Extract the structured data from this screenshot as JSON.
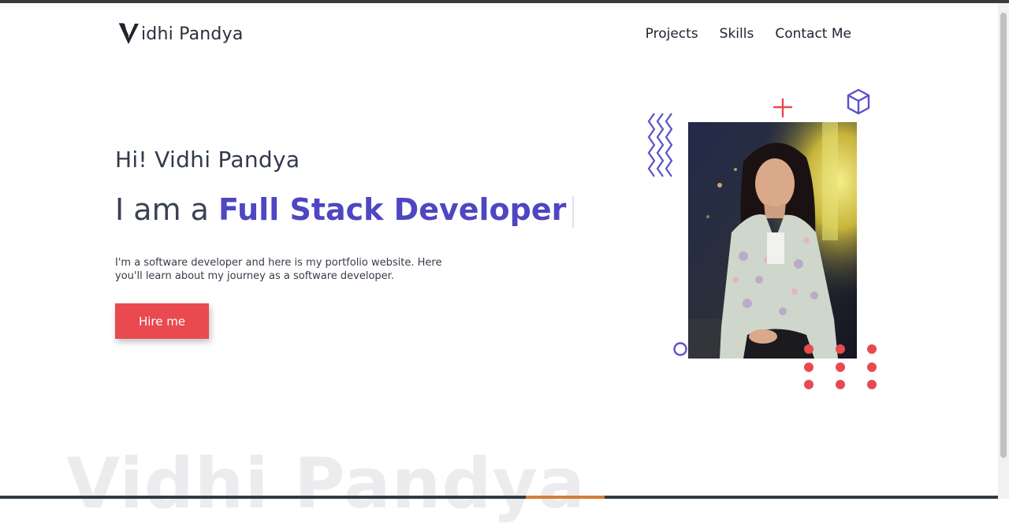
{
  "header": {
    "logo_text": "idhi Pandya",
    "nav": [
      {
        "label": "Projects"
      },
      {
        "label": "Skills"
      },
      {
        "label": "Contact Me"
      }
    ]
  },
  "hero": {
    "greeting": "Hi! Vidhi Pandya",
    "role_prefix": "I am a ",
    "role_highlight": "Full Stack Developer",
    "description": "I'm a software developer and here is my portfolio website. Here you'll learn about my journey as a software developer.",
    "cta_label": "Hire me"
  },
  "watermark": "Vidhi Pandya",
  "colors": {
    "accent_purple": "#4f46c2",
    "cta_red": "#e84a4f",
    "deco_purple": "#5b50c8",
    "deco_red": "#e84a4f"
  },
  "icons": {
    "logo_mark": "v-logo-icon",
    "decor": [
      "zigzag-icon",
      "plus-icon",
      "cube-icon",
      "ring-icon",
      "dot-grid-icon"
    ]
  }
}
